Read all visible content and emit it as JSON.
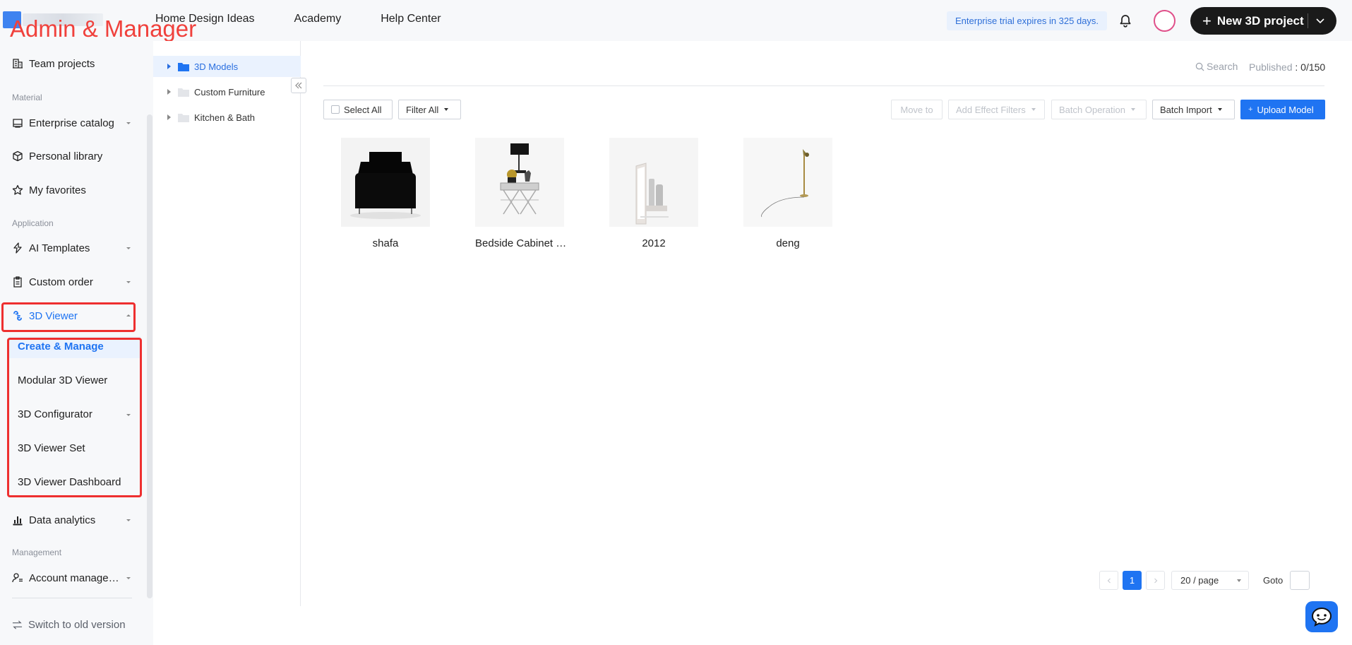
{
  "annotation": {
    "label": "Admin & Manager"
  },
  "topbar": {
    "nav": [
      "Home Design Ideas",
      "Academy",
      "Help Center"
    ],
    "trial_text": "Enterprise trial expires in 325 days.",
    "new_project_label": "New 3D project"
  },
  "sidebar": {
    "team_projects": "Team projects",
    "section_material": "Material",
    "enterprise_catalog": "Enterprise catalog",
    "personal_library": "Personal library",
    "my_favorites": "My favorites",
    "section_application": "Application",
    "ai_templates": "AI Templates",
    "custom_order": "Custom order",
    "viewer_3d": "3D Viewer",
    "viewer_sub": [
      "Create & Manage",
      "Modular 3D Viewer",
      "3D Configurator",
      "3D Viewer Set",
      "3D Viewer Dashboard"
    ],
    "data_analytics": "Data analytics",
    "section_management": "Management",
    "account_manage": "Account manage…",
    "switch_old": "Switch to old version"
  },
  "tree": {
    "items": [
      "3D Models",
      "Custom Furniture",
      "Kitchen & Bath"
    ]
  },
  "toolbar": {
    "search": "Search",
    "published_label": "Published",
    "published_value": ": 0/150",
    "select_all": "Select All",
    "filter_all": "Filter All",
    "move_to": "Move to",
    "add_effect_filters": "Add Effect Filters",
    "batch_operation": "Batch Operation",
    "batch_import": "Batch Import",
    "upload_model": "Upload Model"
  },
  "models": [
    {
      "name": "shafa",
      "thumb": "black-sofa"
    },
    {
      "name": "Bedside Cabinet …",
      "thumb": "bedside-cabinet"
    },
    {
      "name": "2012",
      "thumb": "decor-set"
    },
    {
      "name": "deng",
      "thumb": "floor-lamp"
    }
  ],
  "pagination": {
    "current_page": "1",
    "page_size": "20 / page",
    "goto_label": "Goto"
  },
  "colors": {
    "accent": "#1f74f2",
    "highlight": "#ee2f2f",
    "annotation": "#f0413c"
  }
}
